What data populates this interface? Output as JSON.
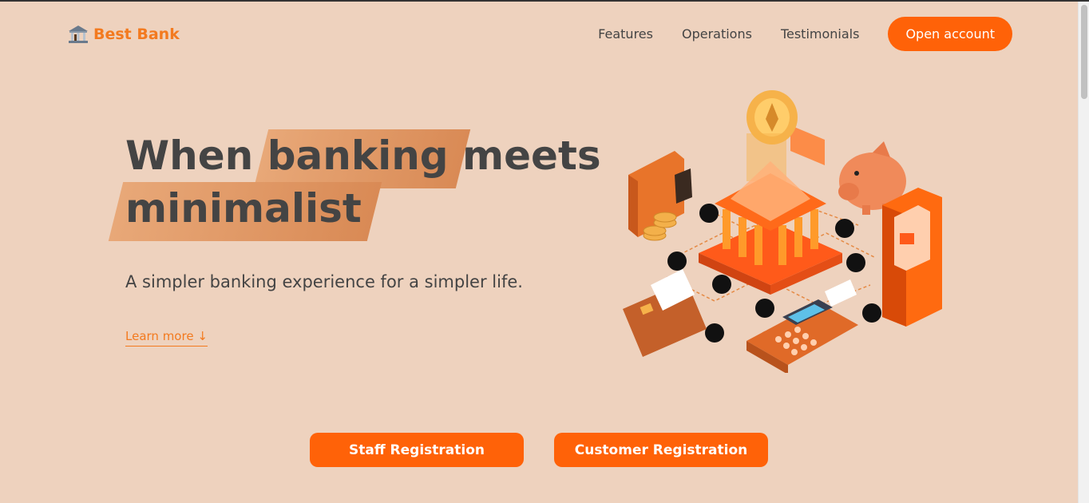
{
  "header": {
    "logo_text": "Best Bank",
    "nav": {
      "features": "Features",
      "operations": "Operations",
      "testimonials": "Testimonials",
      "cta": "Open account"
    }
  },
  "hero": {
    "title_part1": "When",
    "title_highlight1": "banking",
    "title_part2": "meets",
    "title_highlight2": "minimalist",
    "subtitle": "A simpler banking experience for a simpler life.",
    "learn_more": "Learn more ↓"
  },
  "registration": {
    "staff": "Staff Registration",
    "customer": "Customer Registration"
  },
  "colors": {
    "background": "#eed2be",
    "accent": "#ff6208",
    "logo": "#f37a1f",
    "highlight": "#e09a68",
    "text": "#444444"
  }
}
